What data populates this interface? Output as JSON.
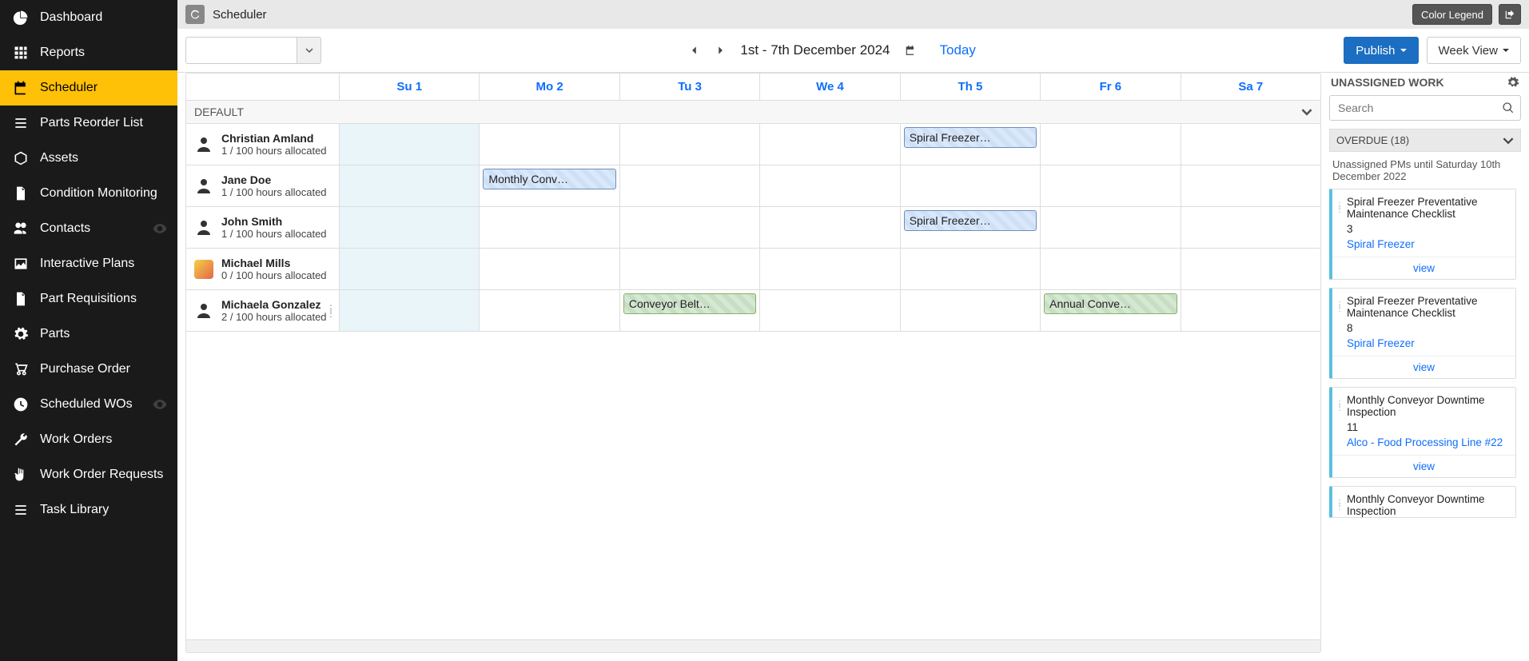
{
  "sidebar": {
    "items": [
      {
        "label": "Dashboard",
        "icon": "pie"
      },
      {
        "label": "Reports",
        "icon": "grid"
      },
      {
        "label": "Scheduler",
        "icon": "calendar",
        "active": true
      },
      {
        "label": "Parts Reorder List",
        "icon": "list"
      },
      {
        "label": "Assets",
        "icon": "cube"
      },
      {
        "label": "Condition Monitoring",
        "icon": "doc"
      },
      {
        "label": "Contacts",
        "icon": "users",
        "eye": true
      },
      {
        "label": "Interactive Plans",
        "icon": "image"
      },
      {
        "label": "Part Requisitions",
        "icon": "doc"
      },
      {
        "label": "Parts",
        "icon": "gear"
      },
      {
        "label": "Purchase Order",
        "icon": "cart"
      },
      {
        "label": "Scheduled WOs",
        "icon": "clock",
        "eye": true
      },
      {
        "label": "Work Orders",
        "icon": "wrench"
      },
      {
        "label": "Work Order Requests",
        "icon": "hand"
      },
      {
        "label": "Task Library",
        "icon": "list"
      }
    ]
  },
  "header": {
    "title": "Scheduler",
    "color_legend": "Color Legend"
  },
  "toolbar": {
    "range": "1st - 7th December 2024",
    "today": "Today",
    "publish": "Publish",
    "view": "Week View"
  },
  "days": [
    "Su 1",
    "Mo 2",
    "Tu 3",
    "We 4",
    "Th 5",
    "Fr 6",
    "Sa 7"
  ],
  "group": "DEFAULT",
  "resources": [
    {
      "name": "Christian Amland",
      "alloc": "1 / 100 hours allocated",
      "tasks": [
        {
          "day": 4,
          "label": "Spiral Freezer…",
          "cls": "blue"
        }
      ]
    },
    {
      "name": "Jane Doe",
      "alloc": "1 / 100 hours allocated",
      "tasks": [
        {
          "day": 1,
          "label": "Monthly Conv…",
          "cls": "blue"
        }
      ]
    },
    {
      "name": "John Smith",
      "alloc": "1 / 100 hours allocated",
      "tasks": [
        {
          "day": 4,
          "label": "Spiral Freezer…",
          "cls": "blue"
        }
      ]
    },
    {
      "name": "Michael Mills",
      "alloc": "0 / 100 hours allocated",
      "tasks": [],
      "avatar": "img"
    },
    {
      "name": "Michaela Gonzalez",
      "alloc": "2 / 100 hours allocated",
      "tasks": [
        {
          "day": 2,
          "label": "Conveyor Belt…",
          "cls": "green"
        },
        {
          "day": 5,
          "label": "Annual Conve…",
          "cls": "green"
        }
      ],
      "drag": true
    }
  ],
  "panel": {
    "heading": "UNASSIGNED WORK",
    "search_placeholder": "Search",
    "overdue_label": "OVERDUE (18)",
    "note": "Unassigned PMs until Saturday 10th December 2022",
    "view_label": "view",
    "cards": [
      {
        "title": "Spiral Freezer Preventative Maintenance Checklist",
        "num": "3",
        "asset": "Spiral Freezer"
      },
      {
        "title": "Spiral Freezer Preventative Maintenance Checklist",
        "num": "8",
        "asset": "Spiral Freezer"
      },
      {
        "title": "Monthly Conveyor Downtime Inspection",
        "num": "11",
        "asset": "Alco - Food Processing Line #22"
      },
      {
        "title": "Monthly Conveyor Downtime Inspection",
        "num": "",
        "asset": ""
      }
    ]
  }
}
